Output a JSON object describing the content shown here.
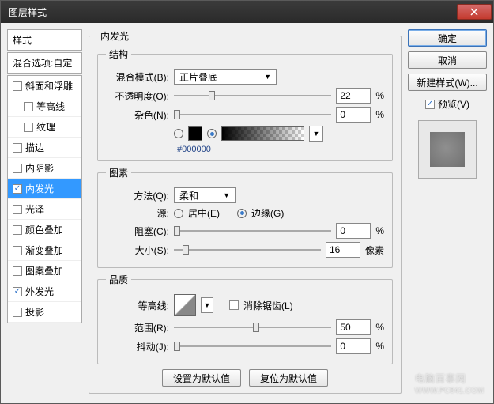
{
  "window": {
    "title": "图层样式"
  },
  "left": {
    "header": "样式",
    "blend_opts": "混合选项:自定",
    "items": [
      {
        "label": "斜面和浮雕",
        "checked": false,
        "indent": false
      },
      {
        "label": "等高线",
        "checked": false,
        "indent": true
      },
      {
        "label": "纹理",
        "checked": false,
        "indent": true
      },
      {
        "label": "描边",
        "checked": false,
        "indent": false
      },
      {
        "label": "内阴影",
        "checked": false,
        "indent": false
      },
      {
        "label": "内发光",
        "checked": true,
        "indent": false,
        "selected": true
      },
      {
        "label": "光泽",
        "checked": false,
        "indent": false
      },
      {
        "label": "颜色叠加",
        "checked": false,
        "indent": false
      },
      {
        "label": "渐变叠加",
        "checked": false,
        "indent": false
      },
      {
        "label": "图案叠加",
        "checked": false,
        "indent": false
      },
      {
        "label": "外发光",
        "checked": true,
        "indent": false
      },
      {
        "label": "投影",
        "checked": false,
        "indent": false
      }
    ]
  },
  "panel": {
    "title": "内发光",
    "structure": {
      "legend": "结构",
      "blend_mode_label": "混合模式(B):",
      "blend_mode_value": "正片叠底",
      "opacity_label": "不透明度(O):",
      "opacity_value": "22",
      "opacity_unit": "%",
      "noise_label": "杂色(N):",
      "noise_value": "0",
      "noise_unit": "%",
      "color_hex": "#000000"
    },
    "elements": {
      "legend": "图素",
      "technique_label": "方法(Q):",
      "technique_value": "柔和",
      "source_label": "源:",
      "source_center": "居中(E)",
      "source_edge": "边缘(G)",
      "choke_label": "阻塞(C):",
      "choke_value": "0",
      "choke_unit": "%",
      "size_label": "大小(S):",
      "size_value": "16",
      "size_unit": "像素"
    },
    "quality": {
      "legend": "品质",
      "contour_label": "等高线:",
      "antialias": "消除锯齿(L)",
      "range_label": "范围(R):",
      "range_value": "50",
      "range_unit": "%",
      "jitter_label": "抖动(J):",
      "jitter_value": "0",
      "jitter_unit": "%"
    },
    "buttons": {
      "make_default": "设置为默认值",
      "reset_default": "复位为默认值"
    }
  },
  "right": {
    "ok": "确定",
    "cancel": "取消",
    "new_style": "新建样式(W)...",
    "preview": "预览(V)"
  },
  "watermark": {
    "main": "电脑百事网",
    "sub": "WWW.PC841.COM"
  }
}
